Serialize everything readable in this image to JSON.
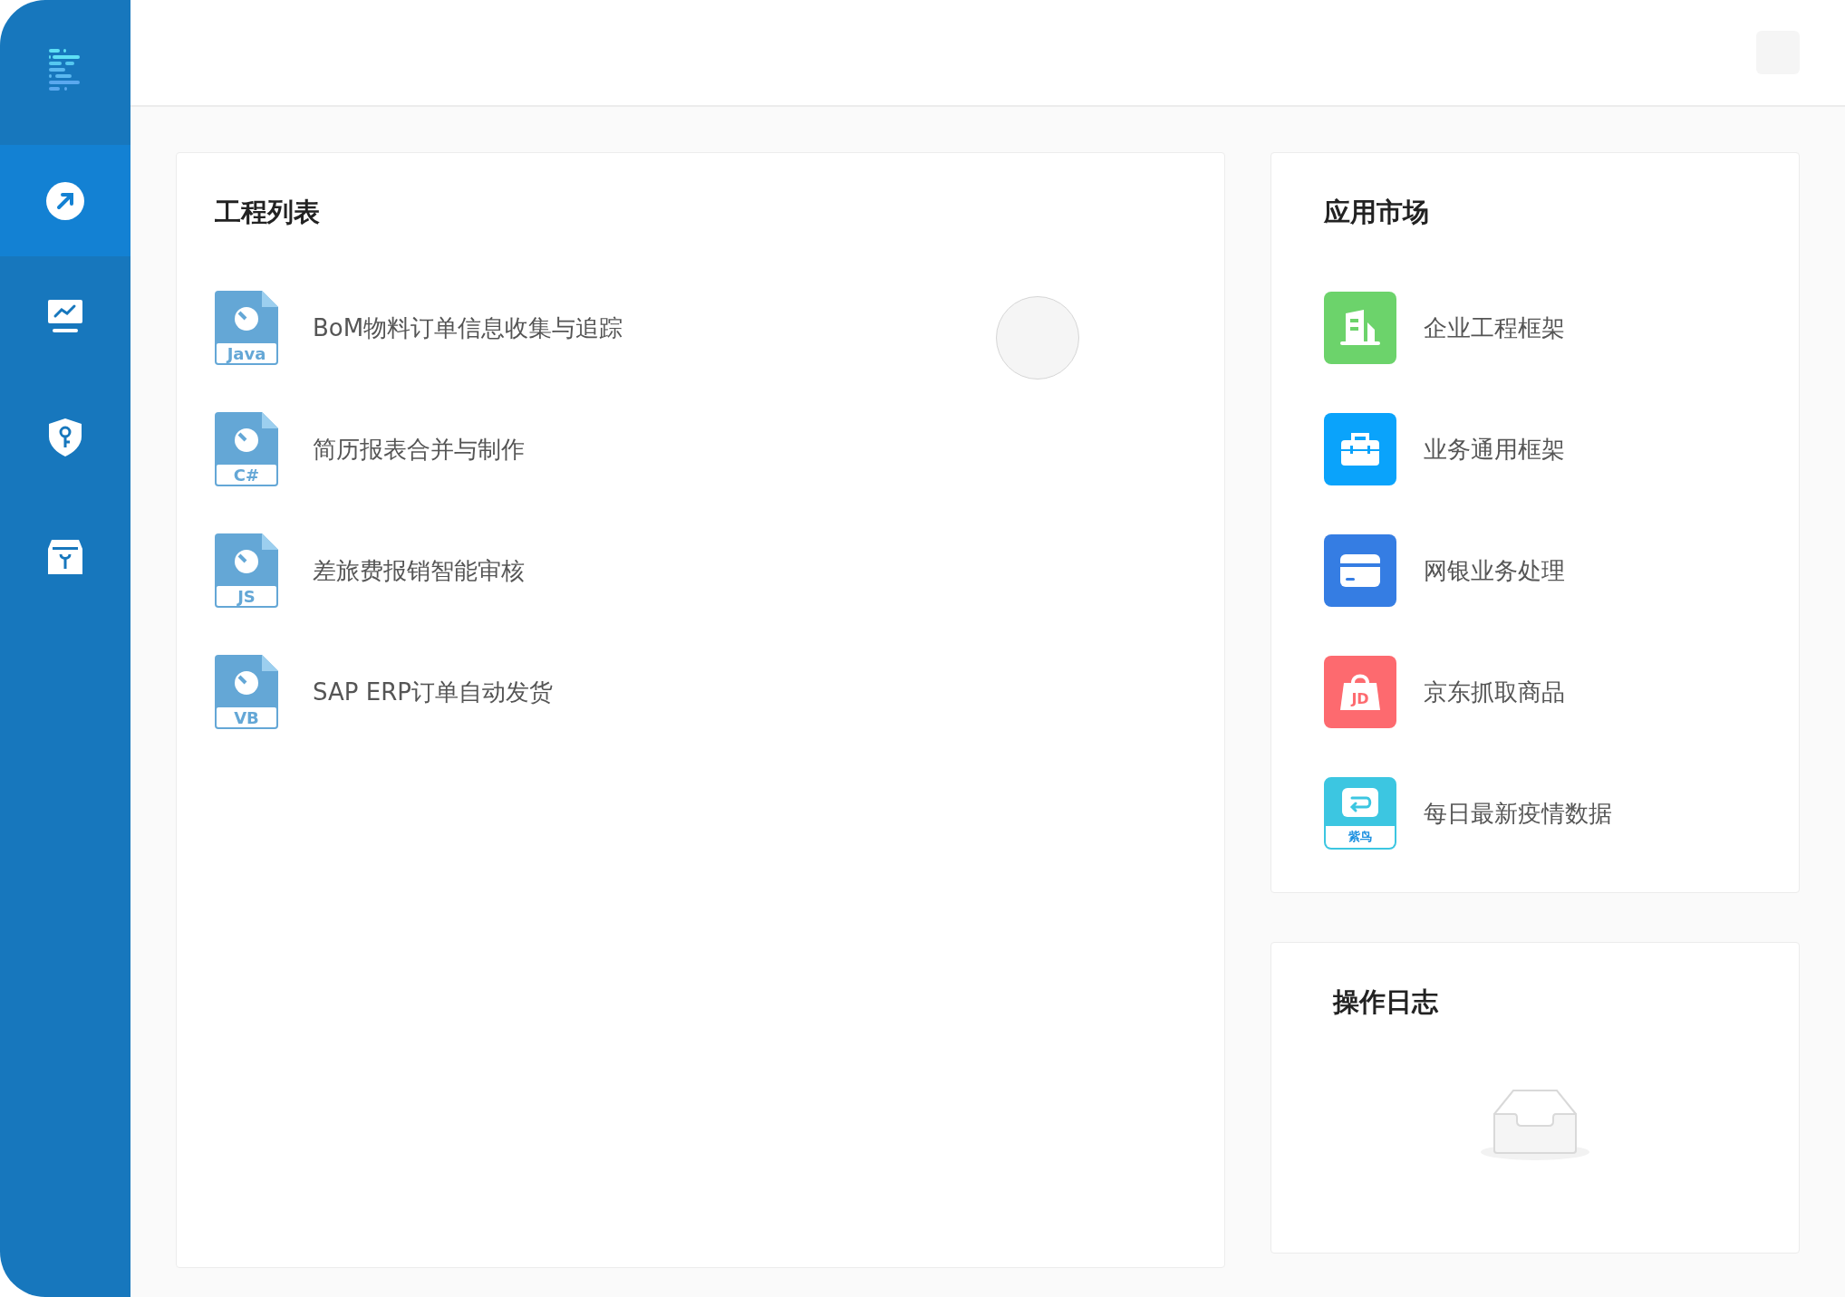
{
  "sidebar": {
    "items": [
      {
        "kind": "launch",
        "selected": true
      },
      {
        "kind": "monitor",
        "selected": false
      },
      {
        "kind": "security",
        "selected": false
      },
      {
        "kind": "toolbox",
        "selected": false
      }
    ]
  },
  "projects": {
    "title": "工程列表",
    "items": [
      {
        "name": "BoM物料订单信息收集与追踪",
        "language": "Java"
      },
      {
        "name": "简历报表合并与制作",
        "language": "C#"
      },
      {
        "name": "差旅费报销智能审核",
        "language": "JS"
      },
      {
        "name": "SAP ERP订单自动发货",
        "language": "VB"
      }
    ]
  },
  "market": {
    "title": "应用市场",
    "items": [
      {
        "name": "企业工程框架",
        "kind": "building",
        "color": "#6cd36b"
      },
      {
        "name": "业务通用框架",
        "kind": "briefcase",
        "color": "#0aa3fb"
      },
      {
        "name": "网银业务处理",
        "kind": "card",
        "color": "#357de3"
      },
      {
        "name": "京东抓取商品",
        "kind": "bag",
        "color": "#fd6a6f",
        "label": "JD"
      },
      {
        "name": "每日最新疫情数据",
        "kind": "inbox",
        "color": "#3cc6e1",
        "badge": "紫鸟"
      }
    ]
  },
  "log": {
    "title": "操作日志"
  }
}
